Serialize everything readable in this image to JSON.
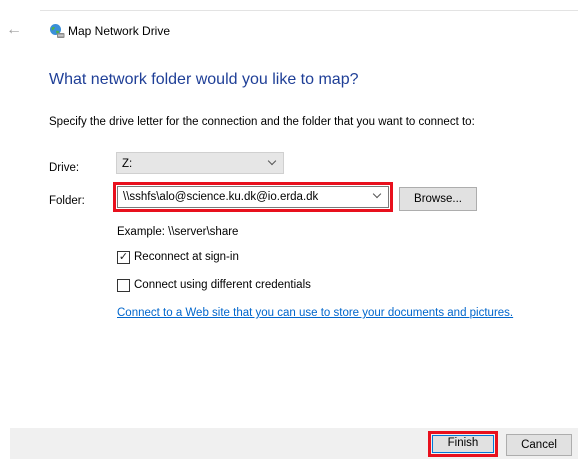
{
  "window": {
    "title": "Map Network Drive",
    "back_icon": "back-arrow-icon",
    "title_icon": "network-drive-icon"
  },
  "main": {
    "heading": "What network folder would you like to map?",
    "instruction": "Specify the drive letter for the connection and the folder that you want to connect to:"
  },
  "drive": {
    "label": "Drive:",
    "value": "Z:"
  },
  "folder": {
    "label": "Folder:",
    "value": "\\\\sshfs\\alo@science.ku.dk@io.erda.dk",
    "browse_label": "Browse...",
    "example": "Example: \\\\server\\share"
  },
  "options": {
    "reconnect_label": "Reconnect at sign-in",
    "reconnect_checked": true,
    "credentials_label": "Connect using different credentials",
    "credentials_checked": false
  },
  "link": {
    "text": "Connect to a Web site that you can use to store your documents and pictures."
  },
  "footer": {
    "finish_label": "Finish",
    "cancel_label": "Cancel"
  },
  "colors": {
    "heading": "#1f3f97",
    "link": "#0066cc",
    "highlight": "#e8101d",
    "footer_bg": "#f0f0f0"
  }
}
